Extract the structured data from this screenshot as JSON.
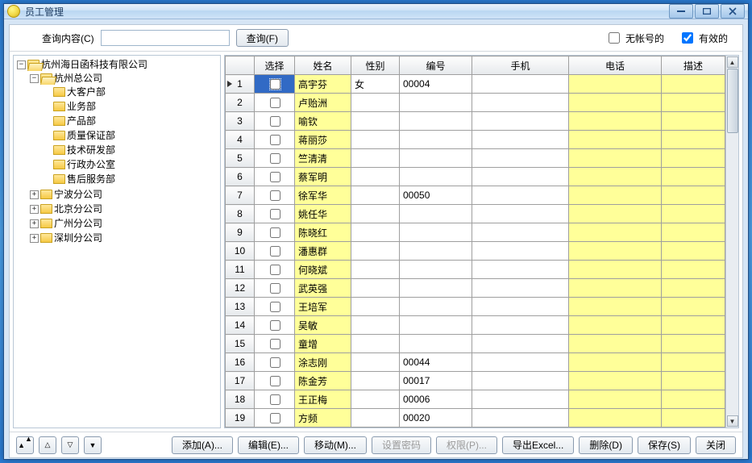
{
  "window": {
    "title": "员工管理"
  },
  "search": {
    "label": "查询内容(C)",
    "value": "",
    "btn": "查询(F)",
    "chk_noaccount": "无帐号的",
    "chk_noaccount_checked": false,
    "chk_valid": "有效的",
    "chk_valid_checked": true
  },
  "tree": {
    "root": {
      "label": "杭州海日函科技有限公司",
      "open": true,
      "children": [
        {
          "label": "杭州总公司",
          "open": true,
          "children": [
            {
              "label": "大客户部"
            },
            {
              "label": "业务部"
            },
            {
              "label": "产品部"
            },
            {
              "label": "质量保证部"
            },
            {
              "label": "技术研发部"
            },
            {
              "label": "行政办公室"
            },
            {
              "label": "售后服务部"
            }
          ]
        },
        {
          "label": "宁波分公司",
          "open": false,
          "children": [
            {}
          ]
        },
        {
          "label": "北京分公司",
          "open": false,
          "children": [
            {}
          ]
        },
        {
          "label": "广州分公司",
          "open": false,
          "children": [
            {}
          ]
        },
        {
          "label": "深圳分公司",
          "open": false,
          "children": [
            {}
          ]
        }
      ]
    }
  },
  "grid": {
    "headers": {
      "select": "选择",
      "name": "姓名",
      "sex": "性别",
      "code": "编号",
      "mobile": "手机",
      "phone": "电话",
      "desc": "描述"
    },
    "rows": [
      {
        "n": 1,
        "checked": false,
        "name": "高宇芬",
        "sex": "女",
        "code": "00004",
        "mobile": "",
        "phone": "",
        "desc": "",
        "selected": true
      },
      {
        "n": 2,
        "checked": false,
        "name": "卢贻洲",
        "sex": "",
        "code": "",
        "mobile": "",
        "phone": "",
        "desc": ""
      },
      {
        "n": 3,
        "checked": false,
        "name": "喻钦",
        "sex": "",
        "code": "",
        "mobile": "",
        "phone": "",
        "desc": ""
      },
      {
        "n": 4,
        "checked": false,
        "name": "蒋丽莎",
        "sex": "",
        "code": "",
        "mobile": "",
        "phone": "",
        "desc": ""
      },
      {
        "n": 5,
        "checked": false,
        "name": "竺清清",
        "sex": "",
        "code": "",
        "mobile": "",
        "phone": "",
        "desc": ""
      },
      {
        "n": 6,
        "checked": false,
        "name": "蔡军明",
        "sex": "",
        "code": "",
        "mobile": "",
        "phone": "",
        "desc": ""
      },
      {
        "n": 7,
        "checked": false,
        "name": "徐军华",
        "sex": "",
        "code": "00050",
        "mobile": "",
        "phone": "",
        "desc": ""
      },
      {
        "n": 8,
        "checked": false,
        "name": "姚任华",
        "sex": "",
        "code": "",
        "mobile": "",
        "phone": "",
        "desc": ""
      },
      {
        "n": 9,
        "checked": false,
        "name": "陈晓红",
        "sex": "",
        "code": "",
        "mobile": "",
        "phone": "",
        "desc": ""
      },
      {
        "n": 10,
        "checked": false,
        "name": "潘惠群",
        "sex": "",
        "code": "",
        "mobile": "",
        "phone": "",
        "desc": ""
      },
      {
        "n": 11,
        "checked": false,
        "name": "何晓斌",
        "sex": "",
        "code": "",
        "mobile": "",
        "phone": "",
        "desc": ""
      },
      {
        "n": 12,
        "checked": false,
        "name": "武英强",
        "sex": "",
        "code": "",
        "mobile": "",
        "phone": "",
        "desc": ""
      },
      {
        "n": 13,
        "checked": false,
        "name": "王培军",
        "sex": "",
        "code": "",
        "mobile": "",
        "phone": "",
        "desc": ""
      },
      {
        "n": 14,
        "checked": false,
        "name": "吴敏",
        "sex": "",
        "code": "",
        "mobile": "",
        "phone": "",
        "desc": ""
      },
      {
        "n": 15,
        "checked": false,
        "name": "童增",
        "sex": "",
        "code": "",
        "mobile": "",
        "phone": "",
        "desc": ""
      },
      {
        "n": 16,
        "checked": false,
        "name": "涂志刚",
        "sex": "",
        "code": "00044",
        "mobile": "",
        "phone": "",
        "desc": ""
      },
      {
        "n": 17,
        "checked": false,
        "name": "陈金芳",
        "sex": "",
        "code": "00017",
        "mobile": "",
        "phone": "",
        "desc": ""
      },
      {
        "n": 18,
        "checked": false,
        "name": "王正梅",
        "sex": "",
        "code": "00006",
        "mobile": "",
        "phone": "",
        "desc": ""
      },
      {
        "n": 19,
        "checked": false,
        "name": "方频",
        "sex": "",
        "code": "00020",
        "mobile": "",
        "phone": "",
        "desc": ""
      }
    ]
  },
  "footer": {
    "add": "添加(A)...",
    "edit": "编辑(E)...",
    "move": "移动(M)...",
    "setpwd": "设置密码",
    "perm": "权限(P)...",
    "export": "导出Excel...",
    "delete": "删除(D)",
    "save": "保存(S)",
    "close": "关闭"
  }
}
